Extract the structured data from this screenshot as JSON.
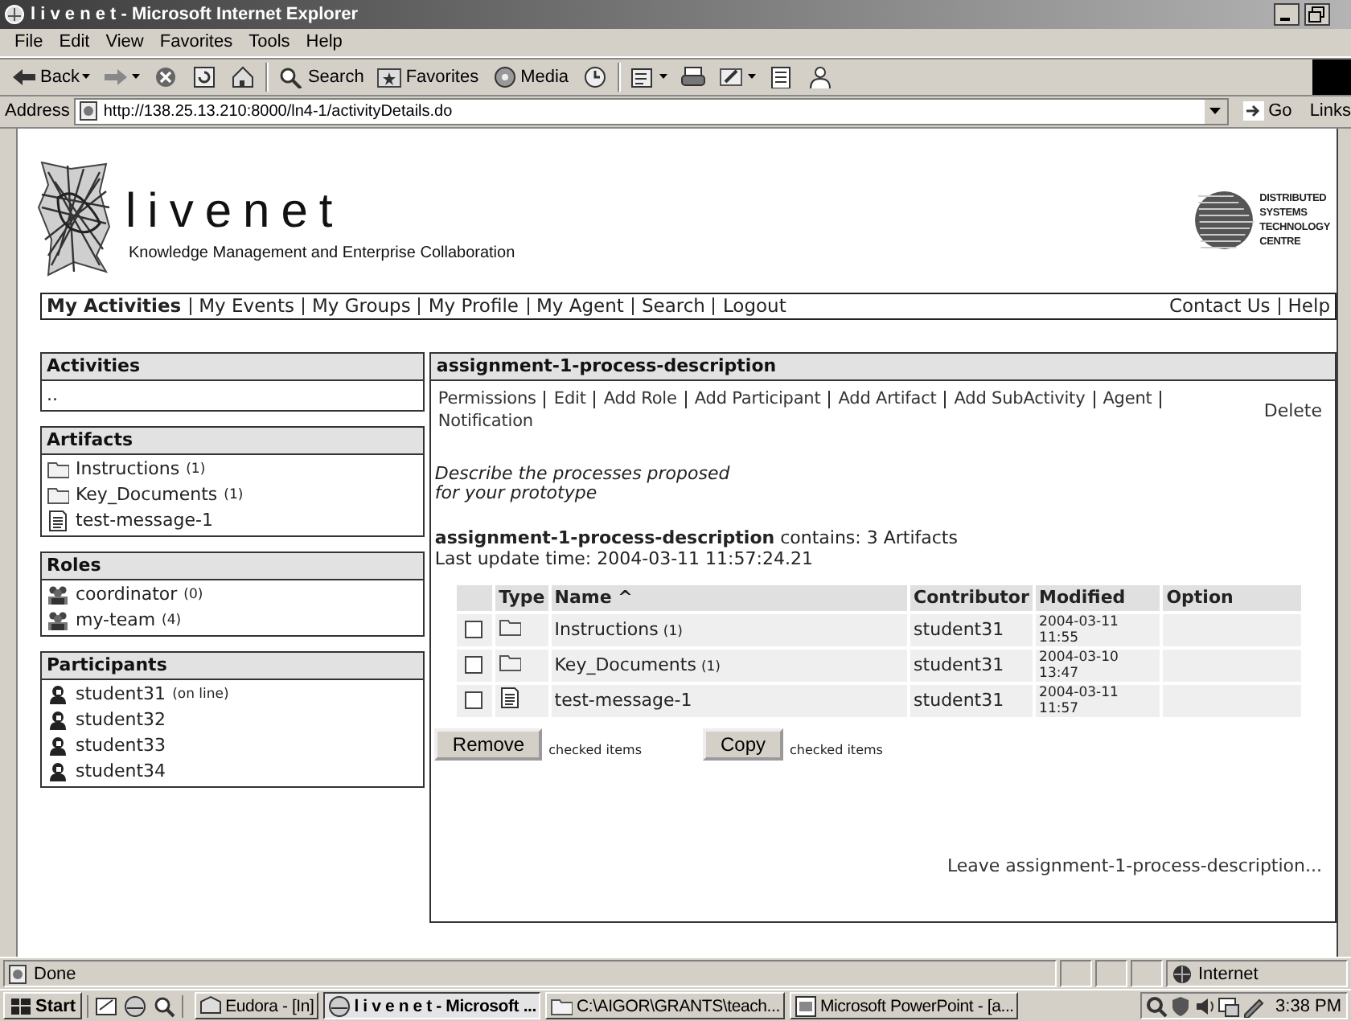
{
  "window": {
    "title": "l i v e n e t - Microsoft Internet Explorer"
  },
  "menu": [
    "File",
    "Edit",
    "View",
    "Favorites",
    "Tools",
    "Help"
  ],
  "toolbar": [
    {
      "kind": "back",
      "label": "Back",
      "menu": true
    },
    {
      "kind": "forward",
      "menu": true
    },
    {
      "kind": "stop"
    },
    {
      "kind": "refresh"
    },
    {
      "kind": "home"
    },
    {
      "kind": "separator"
    },
    {
      "kind": "search",
      "label": "Search"
    },
    {
      "kind": "favorites",
      "label": "Favorites"
    },
    {
      "kind": "media",
      "label": "Media"
    },
    {
      "kind": "history"
    },
    {
      "kind": "separator"
    },
    {
      "kind": "mail",
      "menu": true
    },
    {
      "kind": "print"
    },
    {
      "kind": "edit",
      "menu": true
    },
    {
      "kind": "discuss"
    },
    {
      "kind": "messenger"
    }
  ],
  "address": {
    "label": "Address",
    "value": "http://138.25.13.210:8000/ln4-1/activityDetails.do",
    "go": "Go",
    "links": "Links"
  },
  "site": {
    "name": "livenet",
    "tagline": "Knowledge Management and Enterprise Collaboration",
    "partner": [
      "DISTRIBUTED",
      "SYSTEMS",
      "TECHNOLOGY",
      "CENTRE"
    ]
  },
  "nav": {
    "left": [
      {
        "label": "My Activities",
        "selected": true
      },
      {
        "label": "My Events",
        "selected": false
      },
      {
        "label": "My Groups",
        "selected": false
      },
      {
        "label": "My Profile",
        "selected": false
      },
      {
        "label": "My Agent",
        "selected": false
      },
      {
        "label": "Search",
        "selected": false
      },
      {
        "label": "Logout",
        "selected": false
      }
    ],
    "right": [
      "Contact Us",
      "Help"
    ]
  },
  "sidebar": [
    {
      "title": "Activities",
      "items": [
        {
          "kind": "text",
          "label": ".."
        }
      ]
    },
    {
      "title": "Artifacts",
      "items": [
        {
          "kind": "folder",
          "label": "Instructions",
          "count": "(1)"
        },
        {
          "kind": "folder",
          "label": "Key_Documents",
          "count": "(1)"
        },
        {
          "kind": "document",
          "label": "test-message-1"
        }
      ]
    },
    {
      "title": "Roles",
      "items": [
        {
          "kind": "group",
          "label": "coordinator",
          "count": "(0)"
        },
        {
          "kind": "group",
          "label": "my-team",
          "count": "(4)"
        }
      ]
    },
    {
      "title": "Participants",
      "items": [
        {
          "kind": "person",
          "label": "student31",
          "count": "(on line)"
        },
        {
          "kind": "person",
          "label": "student32"
        },
        {
          "kind": "person",
          "label": "student33"
        },
        {
          "kind": "person",
          "label": "student34"
        }
      ]
    }
  ],
  "activity": {
    "title": "assignment-1-process-description",
    "actions": [
      "Permissions",
      "Edit",
      "Add Role",
      "Add Participant",
      "Add Artifact",
      "Add SubActivity",
      "Agent",
      "Notification"
    ],
    "delete": "Delete",
    "description": [
      "Describe the processes proposed",
      "for your prototype"
    ],
    "summary": "**assignment-1-process-description** contains: 3 Artifacts",
    "updated": "Last update time: 2004-03-11 11:57:24.21",
    "table": {
      "columns": [
        "Type",
        "Name ^",
        "Contributor",
        "Modified",
        "Option"
      ],
      "rows": [
        {
          "checked": false,
          "kind": "folder",
          "name": "Instructions",
          "count": "(1)",
          "contributor": "student31",
          "modified": [
            "2004-03-11",
            "11:55"
          ]
        },
        {
          "checked": false,
          "kind": "folder",
          "name": "Key_Documents",
          "count": "(1)",
          "contributor": "student31",
          "modified": [
            "2004-03-10",
            "13:47"
          ]
        },
        {
          "checked": false,
          "kind": "document",
          "name": "test-message-1",
          "contributor": "student31",
          "modified": [
            "2004-03-11",
            "11:57"
          ]
        }
      ]
    },
    "buttons": [
      {
        "label": "Remove",
        "note": "checked items"
      },
      {
        "label": "Copy",
        "note": "checked items"
      }
    ],
    "leave": "Leave assignment-1-process-description..."
  },
  "status_bar": {
    "text": "Done",
    "zone": "Internet"
  },
  "taskbar": {
    "start": "Start",
    "tasks": [
      {
        "kind": "mail",
        "label": "Eudora - [In]",
        "selected": false
      },
      {
        "kind": "browser",
        "label": "l i v e n e t - Microsoft ...",
        "selected": true
      },
      {
        "kind": "folder",
        "label": "C:\\AIGOR\\GRANTS\\teach...",
        "selected": false
      },
      {
        "kind": "slides",
        "label": "Microsoft PowerPoint - [a...",
        "selected": false
      }
    ],
    "clock": "3:38 PM"
  }
}
